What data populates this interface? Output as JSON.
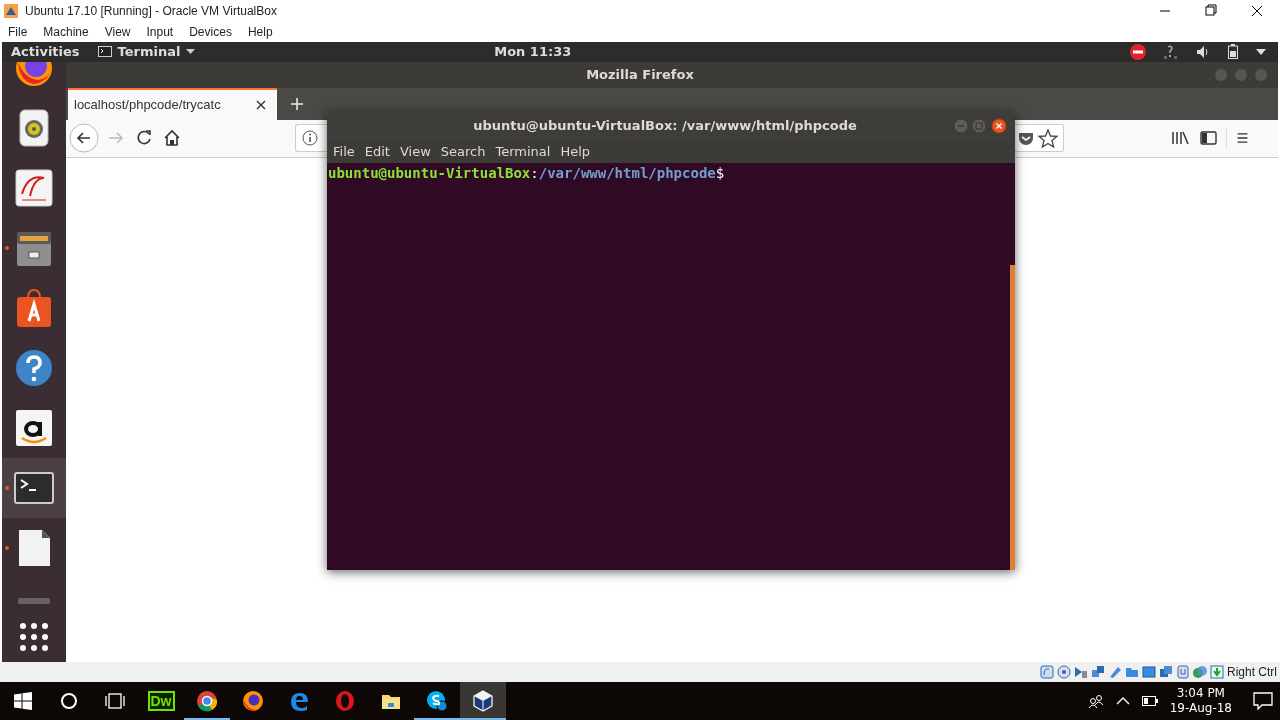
{
  "host_window": {
    "title": "Ubuntu 17.10 [Running] - Oracle VM VirtualBox",
    "menu": [
      "File",
      "Machine",
      "View",
      "Input",
      "Devices",
      "Help"
    ]
  },
  "top_bar": {
    "activities": "Activities",
    "app_menu": "Terminal",
    "clock": "Mon 11:33"
  },
  "dock": {
    "items": [
      {
        "kind": "firefox",
        "running": false,
        "selected": false
      },
      {
        "kind": "speaker",
        "running": false,
        "selected": false
      },
      {
        "kind": "document",
        "running": false,
        "selected": false
      },
      {
        "kind": "files",
        "running": true,
        "selected": false
      },
      {
        "kind": "store",
        "running": false,
        "selected": false
      },
      {
        "kind": "help",
        "running": false,
        "selected": false
      },
      {
        "kind": "amazon",
        "running": false,
        "selected": false
      },
      {
        "kind": "terminal",
        "running": true,
        "selected": true
      },
      {
        "kind": "blank",
        "running": true,
        "selected": false
      },
      {
        "kind": "drive",
        "running": false,
        "selected": false
      }
    ]
  },
  "firefox": {
    "title": "Mozilla Firefox",
    "tab": "localhost/phpcode/trycatc",
    "tab_selected": true
  },
  "terminal": {
    "title": "ubuntu@ubuntu-VirtualBox: /var/www/html/phpcode",
    "menu": [
      "File",
      "Edit",
      "View",
      "Search",
      "Terminal",
      "Help"
    ],
    "prompt": [
      {
        "kind": "user",
        "text": "ubuntu@ubuntu-VirtualBox"
      },
      {
        "kind": "plain",
        "text": ":"
      },
      {
        "kind": "path",
        "text": "/var/www/html/phpcode"
      },
      {
        "kind": "plain",
        "text": "$"
      }
    ]
  },
  "status_bar": {
    "host_key": "Right Ctrl"
  },
  "taskbar": {
    "items": [
      {
        "kind": "dw",
        "label": "Dw",
        "running": false,
        "selected": false
      },
      {
        "kind": "chrome",
        "running": true,
        "selected": false
      },
      {
        "kind": "firefox",
        "running": false,
        "selected": false
      },
      {
        "kind": "edge",
        "running": false,
        "selected": false
      },
      {
        "kind": "opera",
        "running": false,
        "selected": false
      },
      {
        "kind": "folder",
        "running": false,
        "selected": false
      },
      {
        "kind": "skype",
        "running": true,
        "selected": false
      },
      {
        "kind": "virtualbox",
        "running": true,
        "selected": true
      }
    ],
    "time": "3:04 PM",
    "date": "19-Aug-18"
  }
}
